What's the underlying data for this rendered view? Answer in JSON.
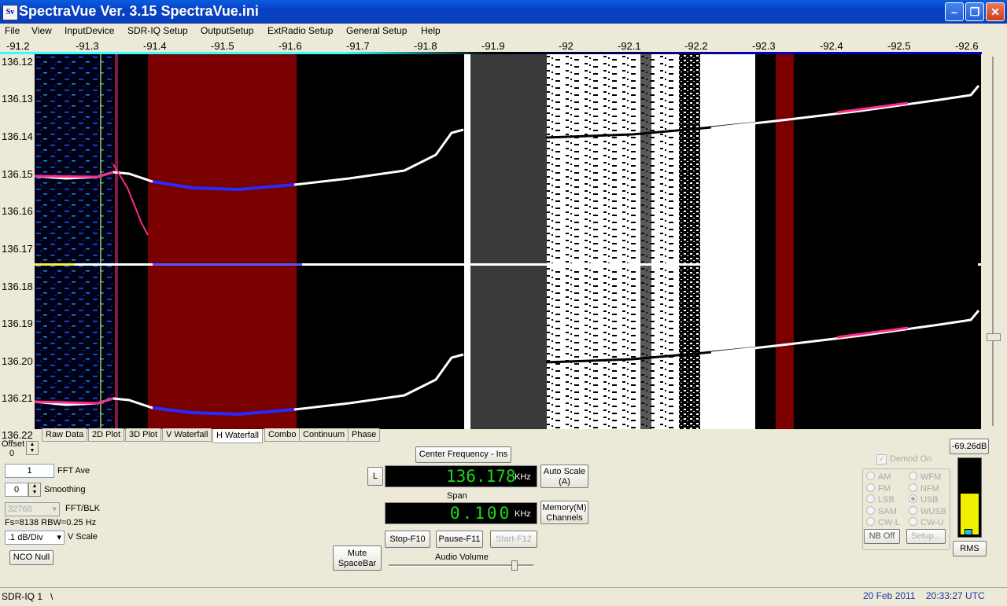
{
  "window": {
    "title": "SpectraVue Ver. 3.15  SpectraVue.ini",
    "icon_text": "Sv"
  },
  "menu": [
    "File",
    "View",
    "InputDevice",
    "SDR-IQ Setup",
    "OutputSetup",
    "ExtRadio Setup",
    "General Setup",
    "Help"
  ],
  "freq_axis": [
    "-91.2",
    "-91.3",
    "-91.4",
    "-91.5",
    "-91.6",
    "-91.7",
    "-91.8",
    "-91.9",
    "-92",
    "-92.1",
    "-92.2",
    "-92.3",
    "-92.4",
    "-92.5",
    "-92.6"
  ],
  "time_axis": [
    "136.12",
    "136.13",
    "136.14",
    "136.15",
    "136.16",
    "136.17",
    "136.18",
    "136.19",
    "136.20",
    "136.21",
    "136.22"
  ],
  "tabs": [
    "Raw Data",
    "2D Plot",
    "3D Plot",
    "V Waterfall",
    "H Waterfall",
    "Combo",
    "Continuum",
    "Phase"
  ],
  "active_tab": "H Waterfall",
  "left_panel": {
    "offset_label": "Offset",
    "offset_value": "0",
    "fft_ave_value": "1",
    "fft_ave_label": "FFT Ave",
    "smoothing_value": "0",
    "smoothing_label": "Smoothing",
    "fft_blk_value": "32768",
    "fft_blk_label": "FFT/BLK",
    "fs_text": "Fs=8138 RBW=0.25 Hz",
    "vscale_value": ".1 dB/Div",
    "vscale_label": "V Scale",
    "nco_null_label": "NCO Null"
  },
  "center": {
    "center_freq_button": "Center Frequency - Ins",
    "l_button": "L",
    "center_freq_value": "136.178",
    "center_freq_unit": "KHz",
    "auto_scale_line1": "Auto Scale",
    "auto_scale_line2": "(A)",
    "span_label": "Span",
    "span_value": "0.100",
    "span_unit": "KHz",
    "memory_line1": "Memory(M)",
    "memory_line2": "Channels",
    "mute_line1": "Mute",
    "mute_line2": "SpaceBar",
    "stop_button": "Stop-F10",
    "pause_button": "Pause-F11",
    "start_button": "Start-F12",
    "audio_volume_label": "Audio Volume"
  },
  "demod": {
    "demod_on_label": "Demod On",
    "modes_left": [
      "AM",
      "FM",
      "LSB",
      "SAM",
      "CW-L"
    ],
    "modes_right": [
      "WFM",
      "NFM",
      "USB",
      "WUSB",
      "CW-U"
    ],
    "selected": "USB",
    "nb_off_label": "NB Off",
    "setup_label": "Setup..."
  },
  "meter": {
    "db_value": "-69.26dB",
    "rms_label": "RMS",
    "fill_fraction": 0.55
  },
  "status": {
    "device": "SDR-IQ 1",
    "separator": "\\",
    "date": "20 Feb 2011",
    "time": "20:33:27 UTC"
  },
  "colors": {
    "waterfall_red": "#7a0000",
    "waterfall_gray": "#3a3a3a",
    "lcd_green": "#1ad91a",
    "trace_blue": "#2a2aff",
    "trace_pink": "#ff2a8a",
    "meter_yellow": "#f0f000"
  }
}
